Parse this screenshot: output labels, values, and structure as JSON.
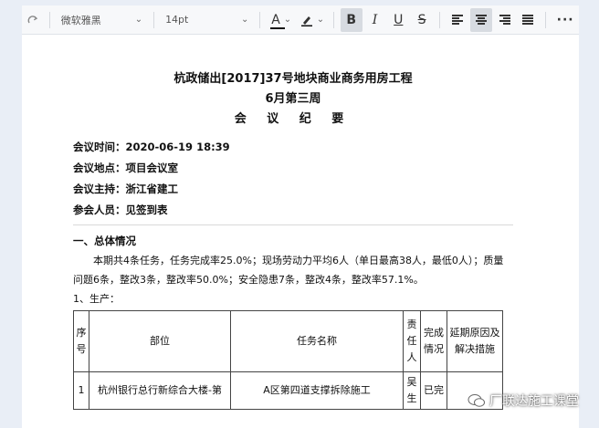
{
  "toolbar": {
    "font_family": "微软雅黑",
    "font_size": "14pt",
    "bold_label": "B",
    "italic_label": "I",
    "underline_label": "U",
    "strike_label": "S",
    "font_color_label": "A",
    "more_label": "···",
    "font_color": "#111111",
    "highlight_color": "#111111"
  },
  "document": {
    "title_line1": "杭政储出[2017]37号地块商业商务用房工程",
    "title_line2": "6月第三周",
    "title_line3": "会 议 纪 要",
    "meeting_time": "会议时间：2020-06-19 18:39",
    "meeting_location": "会议地点：项目会议室",
    "meeting_host": "会议主持：浙江省建工",
    "attendees": "参会人员：见签到表",
    "section1_heading": "一、总体情况",
    "summary": "本期共4条任务，任务完成率25.0%；现场劳动力平均6人（单日最高38人，最低0人）；质量问题6条，整改3条，整改率50.0%；安全隐患7条，整改4条，整改率57.1%。",
    "subsection1": "1、生产：",
    "table": {
      "headers": {
        "seq": "序号",
        "location": "部位",
        "task": "任务名称",
        "owner": "责任人",
        "done": "完成情况",
        "delay": "延期原因及解决措施"
      },
      "row1": {
        "seq": "1",
        "location": "杭州银行总行新综合大楼-第",
        "task": "A区第四道支撑拆除施工",
        "owner": "吴生",
        "done": "已完"
      }
    }
  },
  "watermark": {
    "text": "厂联达施工课堂"
  }
}
